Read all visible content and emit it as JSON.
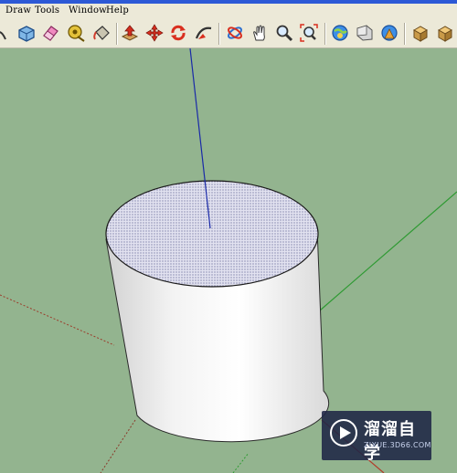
{
  "menu": {
    "items": [
      {
        "label": "Draw"
      },
      {
        "label": "Tools"
      },
      {
        "label": "Window"
      },
      {
        "label": "Help"
      }
    ]
  },
  "toolbar": {
    "tools": [
      {
        "icon": "arc-icon"
      },
      {
        "icon": "make-component-icon"
      },
      {
        "icon": "eraser-icon"
      },
      {
        "icon": "tape-measure-icon"
      },
      {
        "icon": "paint-bucket-icon"
      },
      {
        "icon": "push-pull-icon"
      },
      {
        "icon": "move-icon"
      },
      {
        "icon": "rotate-icon"
      },
      {
        "icon": "follow-me-icon"
      },
      {
        "icon": "orbit-icon"
      },
      {
        "icon": "pan-icon"
      },
      {
        "icon": "zoom-icon"
      },
      {
        "icon": "zoom-extents-icon"
      },
      {
        "icon": "get-models-icon"
      },
      {
        "icon": "share-model-icon"
      },
      {
        "icon": "share-component-icon"
      },
      {
        "icon": "components-icon"
      },
      {
        "icon": "extensions-icon"
      }
    ]
  },
  "viewport": {
    "background_color": "#93b48f",
    "axes": {
      "blue": "#1a2aa8",
      "green": "#2e9a32",
      "red": "#9b3b2a"
    },
    "model": "cylinder"
  },
  "watermark": {
    "title": "溜溜自学",
    "url": "ZIXUE.3D66.COM"
  }
}
